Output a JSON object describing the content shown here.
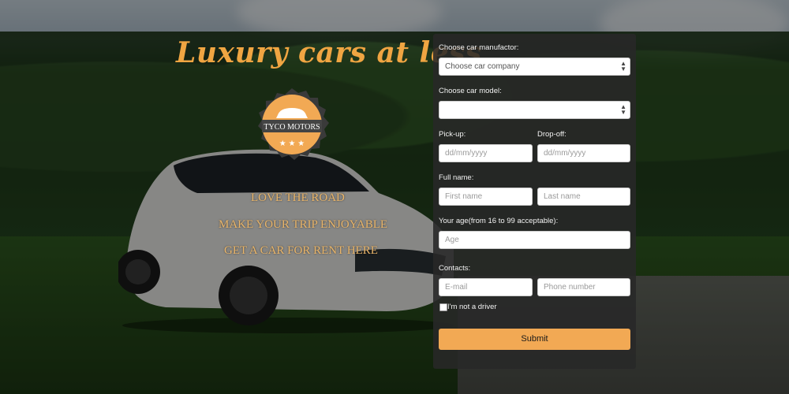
{
  "hero": {
    "headline": "Luxury cars at less",
    "badge_text": "TYCO MOTORS",
    "taglines": [
      "LOVE THE ROAD",
      "MAKE YOUR TRIP ENJOYABLE",
      "GET A CAR FOR RENT HERE"
    ]
  },
  "form": {
    "manufacturer_label": "Choose car manufactor:",
    "manufacturer_value": "Choose car company",
    "model_label": "Choose car model:",
    "model_value": "",
    "pickup_label": "Pick-up:",
    "pickup_placeholder": "dd/mm/yyyy",
    "dropoff_label": "Drop-off:",
    "dropoff_placeholder": "dd/mm/yyyy",
    "fullname_label": "Full name:",
    "firstname_placeholder": "First name",
    "lastname_placeholder": "Last name",
    "age_label": "Your age(from 16 to 99 acceptable):",
    "age_placeholder": "Age",
    "contacts_label": "Contacts:",
    "email_placeholder": "E-mail",
    "phone_placeholder": "Phone number",
    "not_driver_label": "I'm not a driver",
    "not_driver_checked": false,
    "submit_label": "Submit"
  },
  "colors": {
    "accent": "#f2a954",
    "headline": "#f0a542",
    "panel": "#282828"
  }
}
